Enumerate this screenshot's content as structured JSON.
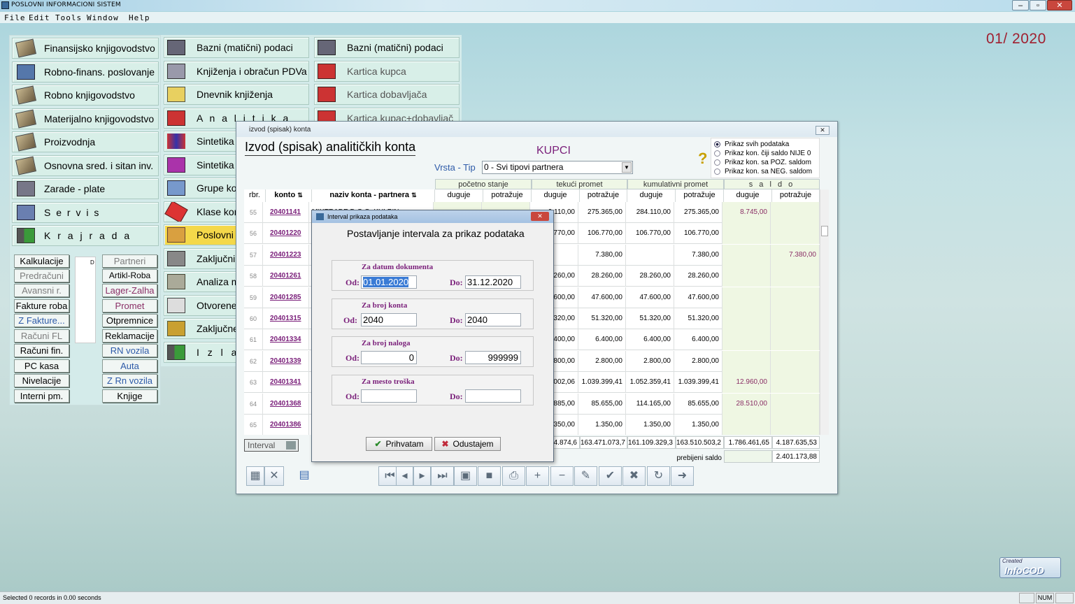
{
  "app": {
    "title": "POSLOVNI  INFORMACIONI  SISTEM",
    "period": "01/ 2020",
    "logo_small": "Created",
    "logo_big": "InfoCOD"
  },
  "menu": [
    "File",
    "Edit",
    "Tools",
    "Window",
    "Help"
  ],
  "left_menu": [
    "Finansijsko knjigovodstvo",
    "Robno-finans. poslovanje",
    "Robno knjigovodstvo",
    "Materijalno knjigovodstvo",
    "Proizvodnja",
    "Osnovna sred. i sitan inv.",
    "Zarade - plate",
    "S e r v i s",
    "K r a j   r a d a"
  ],
  "left_small_l": [
    "Kalkulacije",
    "Predračuni",
    "Avansni r.",
    "Fakture roba",
    "Z Fakture...",
    "Računi FL",
    "Računi fin.",
    "PC kasa",
    "Nivelacije",
    "Interni pm."
  ],
  "left_small_r": [
    "Partneri",
    "Artikl-Roba",
    "Lager-Zalha",
    "Promet",
    "Otpremnice",
    "Reklamacije",
    "RN vozila",
    "Auta",
    "Z Rn vozila",
    "Knjige"
  ],
  "left_small_d": "D",
  "mid_menu": [
    "Bazni (matični) podaci",
    "Knjiženja i obračun PDVa",
    "Dnevnik knjiženja",
    "A n a l i t i k a",
    "Sintetika",
    "Sintetika",
    "Grupe kon",
    "Klase kon",
    "Poslovni p",
    "Zaključni",
    "Analiza m",
    "Otvorene",
    "Zaključne",
    "I z l a z"
  ],
  "right_menu": [
    "Bazni (matični) podaci",
    "Kartica kupca",
    "Kartica dobavljača",
    "Kartica kupac+dobavljač"
  ],
  "window": {
    "title": "izvod (spisak) konta",
    "heading": "Izvod (spisak) analitičkih konta",
    "section": "KUPCI",
    "vrsta_label": "Vrsta - Tip",
    "vrsta_value": "0 - Svi tipovi partnera",
    "radios": [
      "Prikaz svih podataka",
      "Prikaz kon. čiji saldo  NIJE  0",
      "Prikaz kon. sa  POZ. saldom",
      "Prikaz kon. sa  NEG. saldom"
    ],
    "groups": [
      "početno stanje",
      "tekući promet",
      "kumulativni promet",
      "s a l d o"
    ],
    "cols": [
      "rbr.",
      "konto",
      "naziv konta - partnera",
      "duguje",
      "potražuje",
      "duguje",
      "potražuje",
      "duguje",
      "potražuje",
      "duguje",
      "potražuje"
    ],
    "rows": [
      {
        "rb": "55",
        "konto": "20401141",
        "naziv": "MIKTRADE D.O.O. KULPIN",
        "tp_d": "9.110,00",
        "tp_p": "275.365,00",
        "km_d": "284.110,00",
        "km_p": "275.365,00",
        "s_d": "8.745,00",
        "s_p": ""
      },
      {
        "rb": "56",
        "konto": "20401220",
        "naziv": "",
        "tp_d": "106.770,00",
        "tp_p": "106.770,00",
        "km_d": "106.770,00",
        "km_p": "106.770,00",
        "s_d": "",
        "s_p": ""
      },
      {
        "rb": "57",
        "konto": "20401223",
        "naziv": "",
        "tp_d": "",
        "tp_p": "7.380,00",
        "km_d": "",
        "km_p": "7.380,00",
        "s_d": "",
        "s_p": "7.380,00"
      },
      {
        "rb": "58",
        "konto": "20401261",
        "naziv": "",
        "tp_d": "28.260,00",
        "tp_p": "28.260,00",
        "km_d": "28.260,00",
        "km_p": "28.260,00",
        "s_d": "",
        "s_p": ""
      },
      {
        "rb": "59",
        "konto": "20401285",
        "naziv": "",
        "tp_d": "47.600,00",
        "tp_p": "47.600,00",
        "km_d": "47.600,00",
        "km_p": "47.600,00",
        "s_d": "",
        "s_p": ""
      },
      {
        "rb": "60",
        "konto": "20401315",
        "naziv": "",
        "tp_d": "51.320,00",
        "tp_p": "51.320,00",
        "km_d": "51.320,00",
        "km_p": "51.320,00",
        "s_d": "",
        "s_p": ""
      },
      {
        "rb": "61",
        "konto": "20401334",
        "naziv": "",
        "tp_d": "6.400,00",
        "tp_p": "6.400,00",
        "km_d": "6.400,00",
        "km_p": "6.400,00",
        "s_d": "",
        "s_p": ""
      },
      {
        "rb": "62",
        "konto": "20401339",
        "naziv": "",
        "tp_d": "2.800,00",
        "tp_p": "2.800,00",
        "km_d": "2.800,00",
        "km_p": "2.800,00",
        "s_d": "",
        "s_p": ""
      },
      {
        "rb": "63",
        "konto": "20401341",
        "naziv": "",
        "tp_d": "1.052.002,06",
        "tp_p": "1.039.399,41",
        "km_d": "1.052.359,41",
        "km_p": "1.039.399,41",
        "s_d": "12.960,00",
        "s_p": ""
      },
      {
        "rb": "64",
        "konto": "20401368",
        "naziv": "",
        "tp_d": "113.885,00",
        "tp_p": "85.655,00",
        "km_d": "114.165,00",
        "km_p": "85.655,00",
        "s_d": "28.510,00",
        "s_p": ""
      },
      {
        "rb": "65",
        "konto": "20401386",
        "naziv": "",
        "tp_d": "1.350,00",
        "tp_p": "1.350,00",
        "km_d": "1.350,00",
        "km_p": "1.350,00",
        "s_d": "",
        "s_p": ""
      }
    ],
    "totals": [
      "4.874,6",
      "163.471.073,7",
      "161.109.329,3",
      "163.510.503,2",
      "1.786.461,65",
      "4.187.635,53"
    ],
    "prebijeni_label": "prebijeni saldo",
    "prebijeni_value": "2.401.173,88",
    "interval_label": "Interval"
  },
  "dialog": {
    "title": "Interval prikaza podataka",
    "heading": "Postavljanje intervala za prikaz podataka",
    "g1": "Za datum dokumenta",
    "g1_from": "01.01.2020",
    "g1_to": "31.12.2020",
    "g2": "Za broj konta",
    "g2_from": "2040",
    "g2_to": "2040",
    "g3": "Za broj naloga",
    "g3_from": "0",
    "g3_to": "999999",
    "g4": "Za mesto troška",
    "g4_from": "",
    "g4_to": "",
    "od": "Od:",
    "do": "Do:",
    "ok": "Prihvatam",
    "cancel": "Odustajem"
  },
  "status": {
    "text": "Selected 0 records in 0.00 seconds",
    "num": "NUM"
  }
}
